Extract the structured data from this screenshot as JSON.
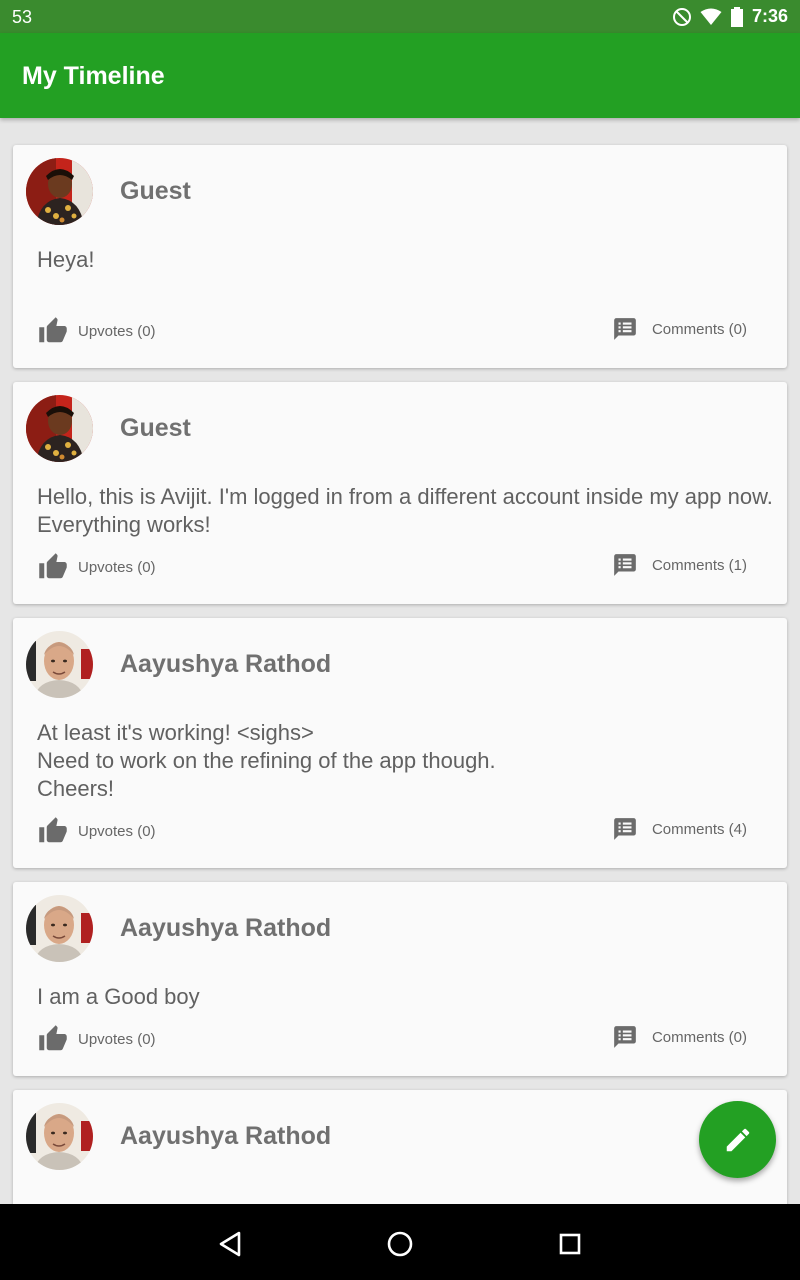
{
  "status_bar": {
    "left_text": "53",
    "time": "7:36"
  },
  "app_bar": {
    "title": "My Timeline"
  },
  "posts": [
    {
      "author": "Guest",
      "text": "Heya!",
      "upvotes_label": "Upvotes (0)",
      "comments_label": "Comments (0)"
    },
    {
      "author": "Guest",
      "text": "Hello, this is Avijit. I'm logged in from a different account inside my app now. Everything works!",
      "upvotes_label": "Upvotes (0)",
      "comments_label": "Comments (1)"
    },
    {
      "author": "Aayushya Rathod",
      "text": "At least it's working! <sighs>\nNeed to work on the refining of the app though.\nCheers!",
      "upvotes_label": "Upvotes (0)",
      "comments_label": "Comments (4)"
    },
    {
      "author": "Aayushya Rathod",
      "text": "I am a Good boy",
      "upvotes_label": "Upvotes (0)",
      "comments_label": "Comments (0)"
    },
    {
      "author": "Aayushya Rathod"
    }
  ],
  "colors": {
    "primary": "#23a023",
    "status_bar": "#3a8b2e",
    "background": "#e6e6e6",
    "card": "#fafafa"
  },
  "icons": [
    "dnd-icon",
    "wifi-icon",
    "battery-icon",
    "thumb-up-icon",
    "comment-icon",
    "edit-icon",
    "back-icon",
    "home-icon",
    "recents-icon"
  ]
}
